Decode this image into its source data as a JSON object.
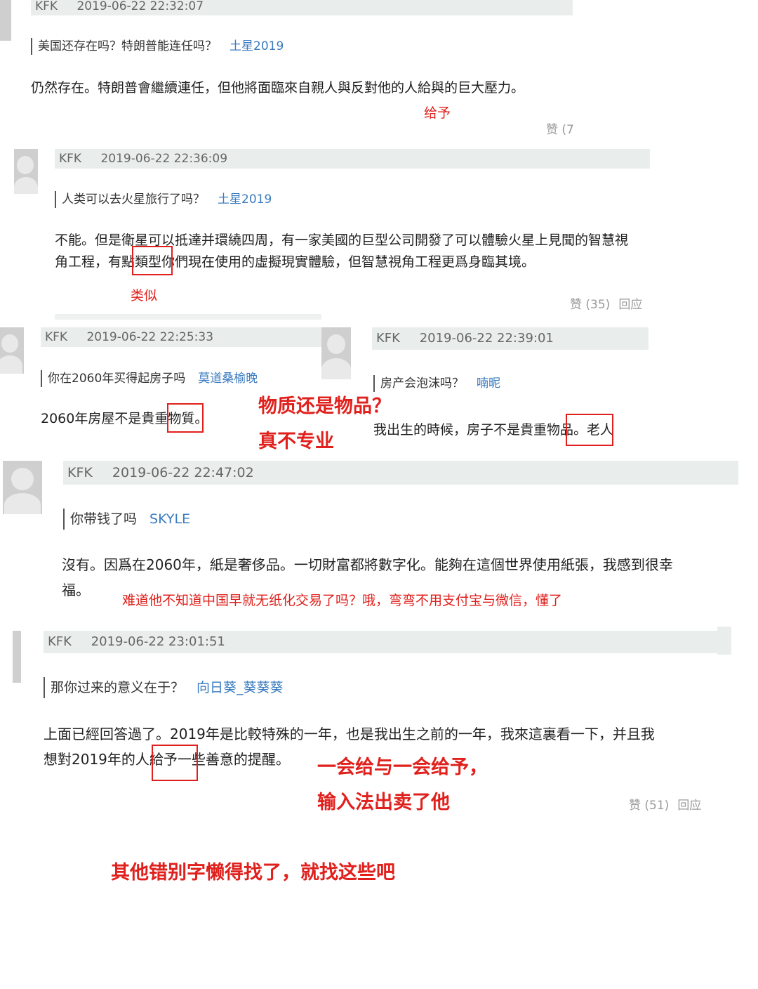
{
  "c1": {
    "user": "KFK",
    "time": "2019-06-22 22:32:07",
    "question": "美国还存在吗？特朗普能连任吗？",
    "asker": "土星2019",
    "answer": "仍然存在。特朗普會繼續連任，但他將面臨來自親人與反對他的人給與的巨大壓力。",
    "likes": "赞 (7"
  },
  "c2": {
    "user": "KFK",
    "time": "2019-06-22 22:36:09",
    "question": "人类可以去火星旅行了吗？",
    "asker": "土星2019",
    "answer_l1": "不能。但是衛星可以抵達并環繞四周，有一家美國的巨型公司開發了可以體驗火星上見聞的智慧視",
    "answer_l2": "角工程，有點類型你們現在使用的虛擬現實體驗，但智慧視角工程更爲身臨其境。",
    "likes": "赞 (35)",
    "reply": "回应"
  },
  "c3": {
    "user": "KFK",
    "time": "2019-06-22 22:25:33",
    "question": "你在2060年买得起房子吗",
    "asker": "莫道桑榆晚",
    "answer": "2060年房屋不是貴重物質。"
  },
  "c4": {
    "user": "KFK",
    "time": "2019-06-22 22:39:01",
    "question": "房产会泡沫吗？",
    "asker": "喃昵",
    "answer": "我出生的時候，房子不是貴重物品。老人"
  },
  "c5": {
    "user": "KFK",
    "time": "2019-06-22 22:47:02",
    "question": "你带钱了吗",
    "asker": "SKYLE",
    "answer_l1": "沒有。因爲在2060年，紙是奢侈品。一切財富都將數字化。能夠在這個世界使用紙張，我感到很幸",
    "answer_l2": "福。"
  },
  "c6": {
    "user": "KFK",
    "time": "2019-06-22 23:01:51",
    "question": "那你过来的意义在于？",
    "asker": "向日葵_葵葵葵",
    "answer_l1": "上面已經回答過了。2019年是比較特殊的一年，也是我出生之前的一年，我來這裏看一下，并且我",
    "answer_l2": "想對2019年的人給予一些善意的提醒。",
    "likes": "赞 (51)",
    "reply": "回应"
  },
  "notes": {
    "n1": "给予",
    "n2": "类似",
    "n3a": "物质还是物品？",
    "n3b": "真不专业",
    "n4": "难道他不知道中国早就无纸化交易了吗？哦，弯弯不用支付宝与微信，懂了",
    "n5a": "一会给与一会给予，",
    "n5b": "输入法出卖了他",
    "n6": "其他错别字懒得找了，就找这些吧"
  },
  "colors": {
    "annotation": "#e0201c",
    "asker_link": "#3a7bbf",
    "header_bar": "#e9eeec"
  }
}
